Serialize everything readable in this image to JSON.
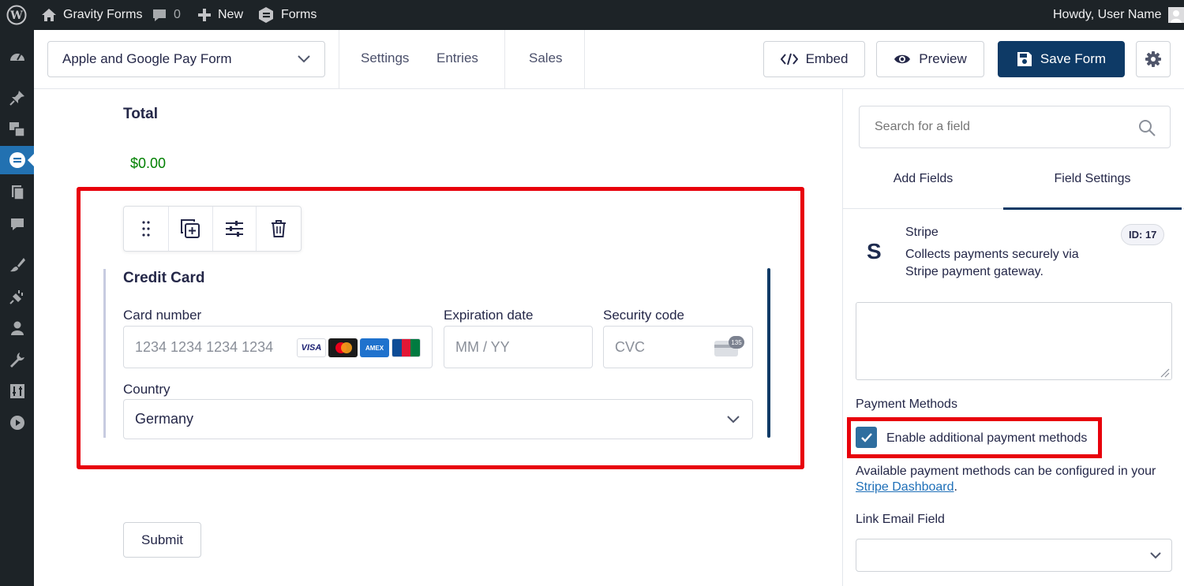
{
  "adminbar": {
    "site_name": "Gravity Forms",
    "comments_count": "0",
    "new_label": "New",
    "forms_label": "Forms",
    "greeting": "Howdy, User Name"
  },
  "toolbar": {
    "form_name": "Apple and Google Pay Form",
    "settings_label": "Settings",
    "entries_label": "Entries",
    "sales_label": "Sales",
    "embed_label": "Embed",
    "preview_label": "Preview",
    "save_label": "Save Form"
  },
  "canvas": {
    "total_label": "Total",
    "total_value": "$0.00",
    "credit_card": {
      "title": "Credit Card",
      "card_number_label": "Card number",
      "card_number_placeholder": "1234 1234 1234 1234",
      "expiration_label": "Expiration date",
      "expiration_placeholder": "MM / YY",
      "security_label": "Security code",
      "security_placeholder": "CVC",
      "cvc_badge": "135",
      "brands": {
        "visa": "VISA",
        "amex": "AMEX",
        "jcb": "JCB"
      },
      "country_label": "Country",
      "country_value": "Germany"
    },
    "submit_label": "Submit"
  },
  "sidebar": {
    "search_placeholder": "Search for a field",
    "tabs": [
      {
        "label": "Add Fields",
        "active": false
      },
      {
        "label": "Field Settings",
        "active": true
      }
    ],
    "field": {
      "name": "Stripe",
      "description_line1": "Collects payments securely via",
      "description_line2": "Stripe payment gateway.",
      "id_badge": "ID: 17",
      "logo": "S"
    },
    "payment_methods_label": "Payment Methods",
    "enable_label": "Enable additional payment methods",
    "enable_checked": true,
    "help_text": "Available payment methods can be configured in your",
    "help_link": "Stripe Dashboard",
    "help_suffix": ".",
    "link_email_label": "Link Email Field"
  },
  "colors": {
    "admin_bg": "#1d2327",
    "primary_button": "#0e3a66",
    "highlight_red": "#e8000b",
    "total_green": "#008000",
    "link_blue": "#1e6fb8"
  }
}
